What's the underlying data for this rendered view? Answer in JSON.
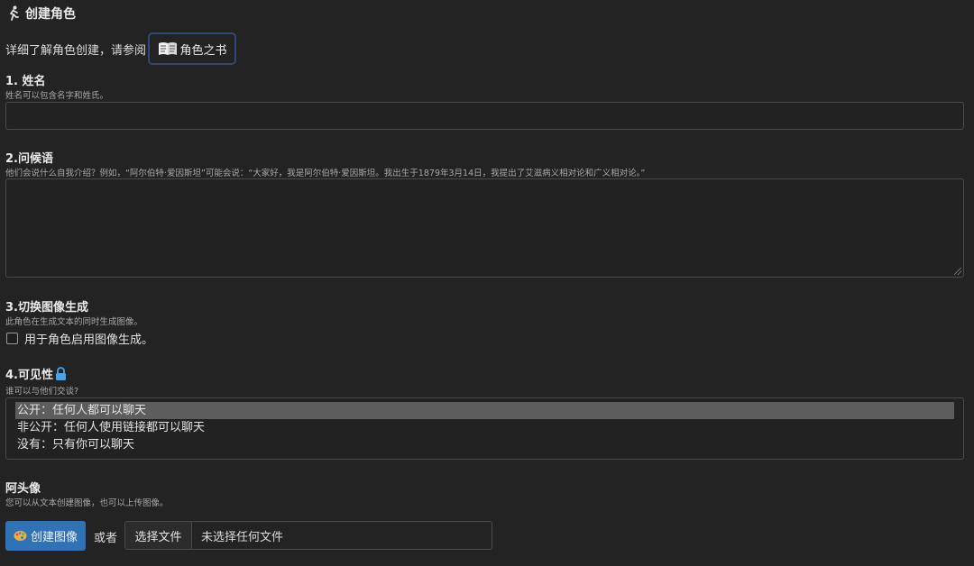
{
  "header": {
    "title": "创建角色",
    "icon": "runner-icon"
  },
  "intro": {
    "text": "详细了解角色创建，请参阅",
    "guide_button": {
      "icon": "book-icon",
      "label": "角色之书"
    }
  },
  "sections": {
    "name": {
      "label": "1. 姓名",
      "hint": "姓名可以包含名字和姓氏。",
      "value": ""
    },
    "greeting": {
      "label": "2.问候语",
      "hint": "他们会说什么自我介绍？例如，“阿尔伯特·爱因斯坦”可能会说：“大家好，我是阿尔伯特·爱因斯坦。我出生于1879年3月14日，我提出了艾滋病义相对论和广义相对论。”",
      "value": ""
    },
    "image_gen": {
      "label": "3.切换图像生成",
      "hint": "此角色在生成文本的同时生成图像。",
      "checkbox_label": "用于角色启用图像生成。",
      "checked": false
    },
    "visibility": {
      "label": "4.可见性",
      "icon": "lock-icon",
      "hint": "谁可以与他们交谈?",
      "options": [
        "公开：任何人都可以聊天",
        "非公开：任何人使用链接都可以聊天",
        "没有：只有你可以聊天"
      ],
      "selected": 0
    },
    "avatar": {
      "label": "阿头像",
      "hint": "您可以从文本创建图像，也可以上传图像。",
      "create_button": {
        "icon": "palette-icon",
        "label": "创建图像"
      },
      "or_text": "或者",
      "file_button": "选择文件",
      "file_status": "未选择任何文件"
    }
  },
  "colors": {
    "background": "#232323",
    "accent": "#2f72b5",
    "guide_border": "#2f4a7a",
    "lock": "#4aa3e8"
  }
}
